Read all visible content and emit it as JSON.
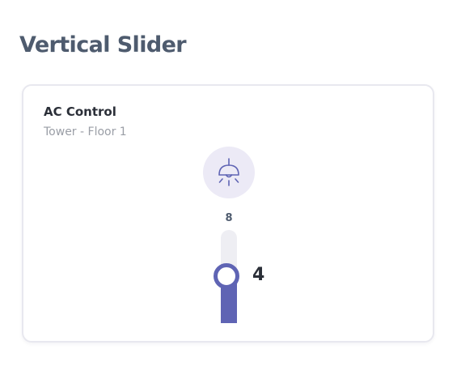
{
  "page": {
    "title": "Vertical Slider"
  },
  "card": {
    "title": "AC Control",
    "subtitle": "Tower - Floor 1",
    "icon": "ceiling-lamp-icon"
  },
  "slider": {
    "min": 0,
    "max_label": "8",
    "max": 8,
    "value": 4,
    "value_label": "4",
    "accent_color": "#5f64b4",
    "track_color": "#eeeef3"
  }
}
